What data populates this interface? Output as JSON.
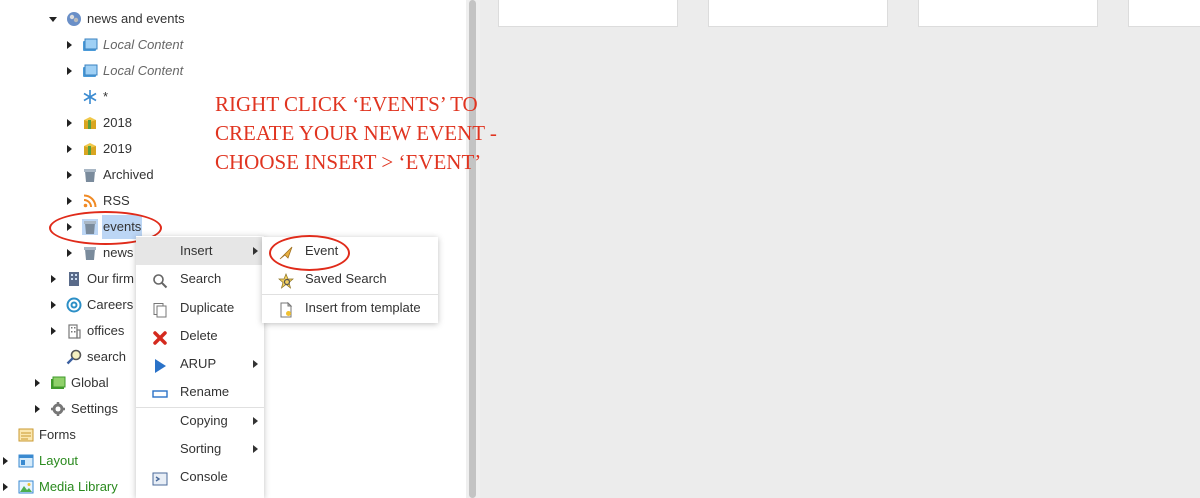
{
  "tree": {
    "news_and_events": "news and events",
    "local_content_1": "Local Content",
    "local_content_2": "Local Content",
    "star": "*",
    "y2018": "2018",
    "y2019": "2019",
    "archived": "Archived",
    "rss": "RSS",
    "events": "events",
    "news": "news",
    "our_firm": "Our firm",
    "careers": "Careers",
    "offices": "offices",
    "search": "search",
    "global": "Global",
    "settings": "Settings",
    "forms": "Forms",
    "layout": "Layout",
    "media_library": "Media Library"
  },
  "annotation": {
    "line1": "RIGHT CLICK ‘EVENTS’ TO",
    "line2": "CREATE YOUR NEW EVENT -",
    "line3": "CHOOSE INSERT > ‘EVENT’",
    "color": "#e03420"
  },
  "context_menu": {
    "insert": "Insert",
    "search": "Search",
    "duplicate": "Duplicate",
    "delete": "Delete",
    "arup": "ARUP",
    "rename": "Rename",
    "copying": "Copying",
    "sorting": "Sorting",
    "console": "Console"
  },
  "insert_submenu": {
    "event": "Event",
    "saved_search": "Saved Search",
    "insert_from_template": "Insert from template"
  },
  "colors": {
    "selection": "#bcd6f5",
    "green_label": "#2a8a1e",
    "content_bg": "#ececec"
  }
}
